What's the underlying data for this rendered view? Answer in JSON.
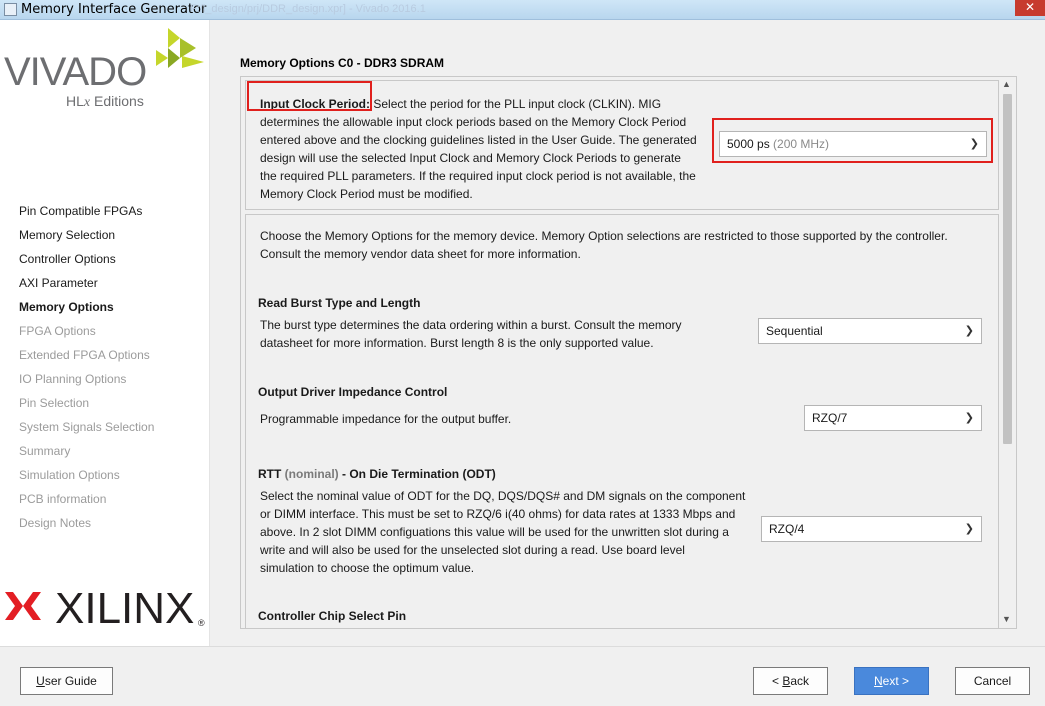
{
  "window": {
    "title": "Memory Interface Generator",
    "faint_title": "F:/l_design/prj/DDR_design.xpr] - Vivado 2016.1",
    "close_glyph": "✕"
  },
  "branding": {
    "vivado": "VIVADO",
    "vivado_reg": ".",
    "hlx_prefix": "HL",
    "hlx_x": "x",
    "hlx_suffix": " Editions",
    "xilinx": "XILINX",
    "xilinx_reg": "®"
  },
  "nav": {
    "items": [
      {
        "label": "Pin Compatible FPGAs",
        "state": "enabled"
      },
      {
        "label": "Memory Selection",
        "state": "enabled"
      },
      {
        "label": "Controller Options",
        "state": "enabled"
      },
      {
        "label": "AXI Parameter",
        "state": "enabled"
      },
      {
        "label": "Memory Options",
        "state": "active"
      },
      {
        "label": "FPGA Options",
        "state": "disabled"
      },
      {
        "label": "Extended FPGA Options",
        "state": "disabled"
      },
      {
        "label": "IO Planning Options",
        "state": "disabled"
      },
      {
        "label": "Pin Selection",
        "state": "disabled"
      },
      {
        "label": "System Signals Selection",
        "state": "disabled"
      },
      {
        "label": "Summary",
        "state": "disabled"
      },
      {
        "label": "Simulation Options",
        "state": "disabled"
      },
      {
        "label": "PCB information",
        "state": "disabled"
      },
      {
        "label": "Design Notes",
        "state": "disabled"
      }
    ]
  },
  "main": {
    "section_title": "Memory Options C0 - DDR3 SDRAM",
    "input_clock": {
      "label": "Input Clock Period:",
      "lines": [
        "Select the period for the PLL input clock (CLKIN). MIG",
        "determines the allowable input clock periods based on the Memory Clock Period",
        "entered above and the clocking guidelines listed in the User Guide. The generated",
        "design will use the selected Input Clock and Memory Clock Periods to generate",
        "the required PLL parameters. If the required input clock period is not available, the",
        "Memory Clock Period must be modified."
      ],
      "value": "5000 ps",
      "value_hint": "(200 MHz)"
    },
    "options_intro": [
      "Choose the Memory Options for the memory device. Memory Option selections are restricted to those supported by the controller.",
      "Consult the memory vendor data sheet for more information."
    ],
    "burst": {
      "title": "Read Burst Type and Length",
      "lines": [
        "The burst type determines the data ordering within a burst. Consult the memory",
        "datasheet for more information. Burst length 8 is the only supported value."
      ],
      "value": "Sequential"
    },
    "odic": {
      "title": "Output Driver Impedance Control",
      "lines": [
        "Programmable impedance for the output buffer."
      ],
      "value": "RZQ/7"
    },
    "rtt": {
      "title_prefix": "RTT",
      "title_muted": "(nominal)",
      "title_suffix": "- On Die Termination (ODT)",
      "lines": [
        "Select the nominal value of ODT for the DQ, DQS/DQS# and DM signals on the component",
        "or DIMM interface. This must be set to RZQ/6 i(40 ohms) for data rates at 1333 Mbps and",
        "above. In 2 slot DIMM configuations this value will be used for the unwritten slot during a",
        "write and will also be used for the unselected slot during a read. Use board level",
        "simulation to choose the optimum value."
      ],
      "value": "RZQ/4"
    },
    "chip_select": {
      "title": "Controller Chip Select Pin"
    }
  },
  "footer": {
    "user_guide": {
      "u": "U",
      "rest": "ser Guide"
    },
    "back": {
      "pre": "< ",
      "u": "B",
      "rest": "ack"
    },
    "next": {
      "u": "N",
      "rest": "ext >"
    },
    "cancel": "Cancel"
  },
  "colors": {
    "highlight": "#e0201d",
    "primary_button": "#4a89dc",
    "vivado_green_light": "#c5d62b",
    "vivado_green_dark": "#8aa823",
    "xilinx_red": "#e31e24"
  },
  "icons": {
    "dropdown": "chevron-down-icon",
    "scroll_up": "arrow-up-icon",
    "scroll_down": "arrow-down-icon"
  }
}
